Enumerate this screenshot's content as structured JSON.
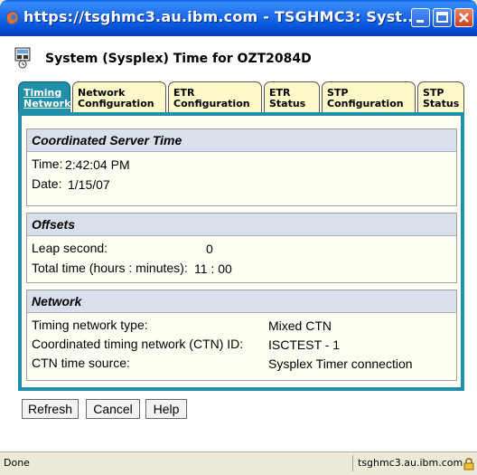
{
  "window": {
    "title": "https://tsghmc3.au.ibm.com - TSGHMC3: Syst..."
  },
  "dialog": {
    "title": "System (Sysplex) Time for OZT2084D"
  },
  "tabs": [
    {
      "label": "Timing\nNetwork",
      "active": true
    },
    {
      "label": "Network\nConfiguration",
      "active": false
    },
    {
      "label": "ETR\nConfiguration",
      "active": false
    },
    {
      "label": "ETR\nStatus",
      "active": false
    },
    {
      "label": "STP\nConfiguration",
      "active": false
    },
    {
      "label": "STP\nStatus",
      "active": false
    }
  ],
  "sections": {
    "cst": {
      "header": "Coordinated Server Time",
      "time_label": "Time:",
      "time_value": "2:42:04 PM",
      "date_label": "Date:",
      "date_value": "1/15/07"
    },
    "offsets": {
      "header": "Offsets",
      "leap_label": "Leap second:",
      "leap_value": "0",
      "total_label": "Total time (hours : minutes):",
      "total_value": "11 : 00"
    },
    "network": {
      "header": "Network",
      "type_label": "Timing network type:",
      "type_value": "Mixed CTN",
      "id_label": "Coordinated timing network (CTN) ID:",
      "id_value": "ISCTEST - 1",
      "source_label": "CTN time source:",
      "source_value": "Sysplex Timer connection"
    }
  },
  "buttons": {
    "refresh": "Refresh",
    "cancel": "Cancel",
    "help": "Help"
  },
  "statusbar": {
    "left": "Done",
    "right": "tsghmc3.au.ibm.com"
  },
  "colors": {
    "titlebar": "#0757dc",
    "active_tab": "#1f8faa",
    "inactive_tab": "#fff8c8",
    "section_header": "#d8e0ec"
  }
}
